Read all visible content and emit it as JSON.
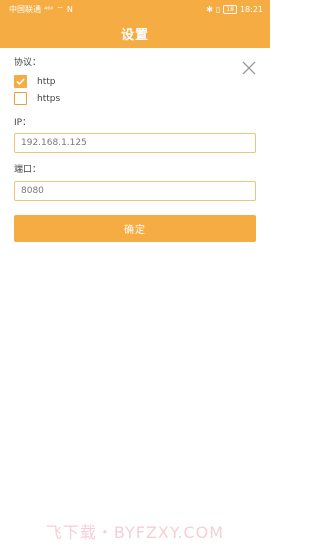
{
  "status_bar": {
    "carrier": "中国联通",
    "signal_glyph": "⁴⁶ᴵᴵ",
    "wifi_glyph": "⌔",
    "nfc_glyph": "N",
    "bluetooth_glyph": "✱",
    "vibrate_glyph": "▯",
    "battery": "18",
    "time": "18:21"
  },
  "header": {
    "title": "设置"
  },
  "protocol": {
    "label": "协议：",
    "options": [
      {
        "label": "http",
        "checked": true
      },
      {
        "label": "https",
        "checked": false
      }
    ]
  },
  "ip": {
    "label": "IP：",
    "value": "192.168.1.125"
  },
  "port": {
    "label": "端口：",
    "value": "8080"
  },
  "confirm_label": "确定",
  "watermark": "飞下载・BYFZXY.COM",
  "colors": {
    "accent": "#f5ad43",
    "input_border": "#e7c779",
    "watermark": "#f6cfd6"
  }
}
